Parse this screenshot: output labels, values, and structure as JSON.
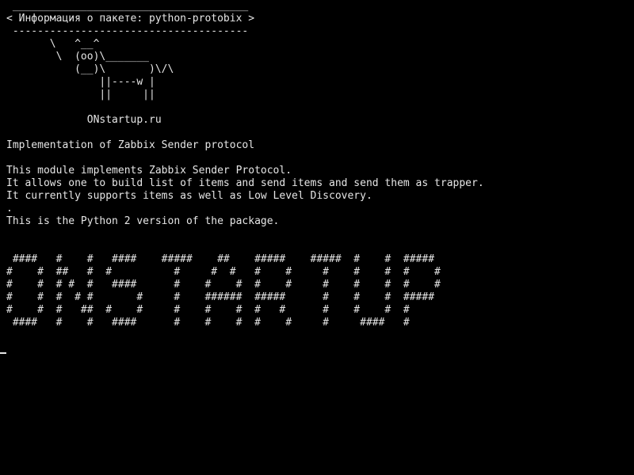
{
  "terminal": {
    "lines": [
      " ______________________________________",
      "< Информация о пакете: python-protobix >",
      " --------------------------------------",
      "       \\   ^__^",
      "        \\  (oo)\\_______",
      "           (__)\\       )\\/\\",
      "               ||----w |",
      "               ||     ||",
      "",
      "             ONstartup.ru",
      "",
      "Implementation of Zabbix Sender protocol",
      "",
      "This module implements Zabbix Sender Protocol.",
      "It allows one to build list of items and send items and send them as trapper.",
      "It currently supports items as well as Low Level Discovery.",
      ".",
      "This is the Python 2 version of the package.",
      "",
      "",
      " ####   #    #   ####    #####    ##    #####    #####  #    #  #####",
      "#    #  ##   #  #          #     #  #   #    #     #    #    #  #    #",
      "#    #  # #  #   ####      #    #    #  #    #     #    #    #  #    #",
      "#    #  #  # #       #     #    ######  #####      #    #    #  #####",
      "#    #  #   ##  #    #     #    #    #  #   #      #    #    #  #",
      " ####   #    #   ####      #    #    #  #    #     #     ####   #"
    ]
  }
}
